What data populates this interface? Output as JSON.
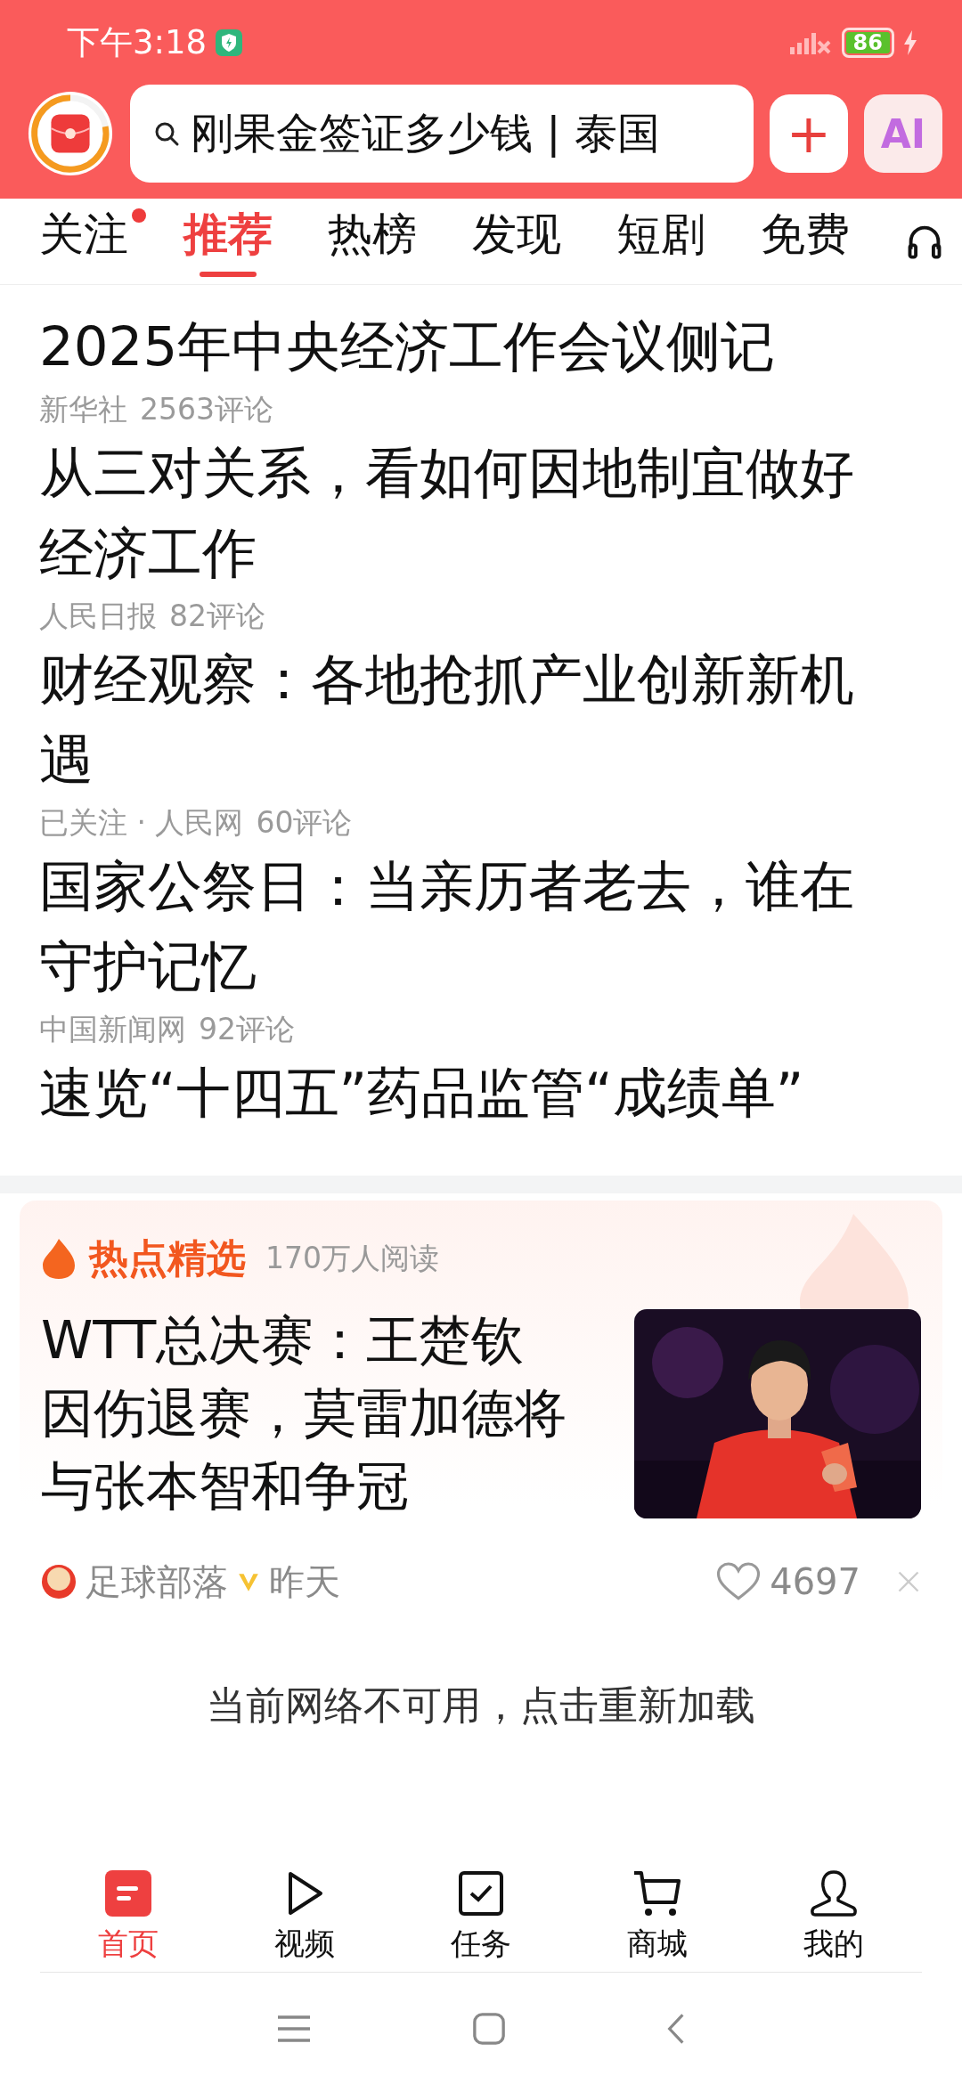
{
  "status_bar": {
    "time": "下午3:18",
    "battery": "86"
  },
  "search": {
    "value": "刚果金签证多少钱 | 泰国"
  },
  "header_buttons": [
    {
      "kind": "plus",
      "label": "+"
    },
    {
      "kind": "ai",
      "label": "AI"
    }
  ],
  "tabs": [
    {
      "label": "关注",
      "selected": false,
      "dot": true
    },
    {
      "label": "推荐",
      "selected": true,
      "dot": false
    },
    {
      "label": "热榜",
      "selected": false,
      "dot": false
    },
    {
      "label": "发现",
      "selected": false,
      "dot": false
    },
    {
      "label": "短剧",
      "selected": false,
      "dot": false
    },
    {
      "label": "免费",
      "selected": false,
      "dot": false
    }
  ],
  "news": [
    {
      "title": "2025年中央经济工作会议侧记",
      "meta": [
        "新华社",
        "2563评论"
      ]
    },
    {
      "title": "从三对关系，看如何因地制宜做好经济工作",
      "meta": [
        "人民日报",
        "82评论"
      ]
    },
    {
      "title": "财经观察：各地抢抓产业创新新机遇",
      "meta": [
        "已关注 · 人民网",
        "60评论"
      ]
    },
    {
      "title": "国家公祭日：当亲历者老去，谁在守护记忆",
      "meta": [
        "中国新闻网",
        "92评论"
      ]
    },
    {
      "title": "速览“十四五”药品监管“成绩单”"
    }
  ],
  "hot": {
    "label": "热点精选",
    "reads": "170万人阅读",
    "title": "WTT总决赛：王楚钦因伤退赛，莫雷加德将与张本智和争冠",
    "source": "足球部落",
    "verified": true,
    "time": "昨天",
    "likes": "4697"
  },
  "network_notice": "当前网络不可用，点击重新加载",
  "bottom_nav": [
    {
      "label": "首页",
      "kind": "home",
      "selected": true
    },
    {
      "label": "视频",
      "kind": "video",
      "selected": false
    },
    {
      "label": "任务",
      "kind": "task",
      "selected": false
    },
    {
      "label": "商城",
      "kind": "cart",
      "selected": false
    },
    {
      "label": "我的",
      "kind": "me",
      "selected": false
    }
  ]
}
